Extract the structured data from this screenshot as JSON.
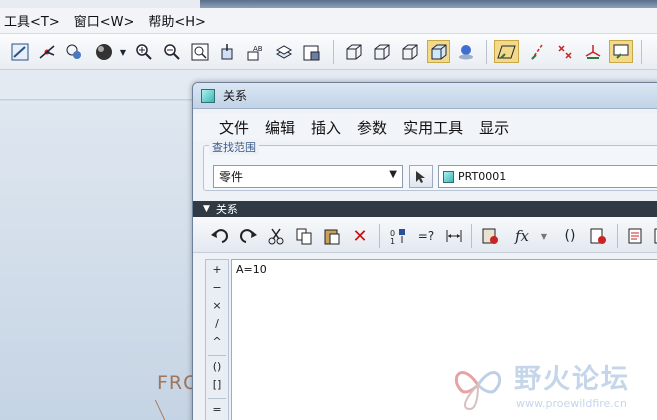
{
  "app_menu": {
    "items": [
      "工具<T>",
      "窗口<W>",
      "帮助<H>"
    ]
  },
  "toolbar": {
    "icons": [
      "repaint-icon",
      "spin-center-icon",
      "orient-icon",
      "appearance-icon",
      "zoom-in-icon",
      "zoom-out-icon",
      "refit-icon",
      "saved-views-icon",
      "annotation-icon",
      "layers-icon",
      "view-manager-icon",
      "wireframe-icon",
      "hidden-line-icon",
      "no-hidden-icon",
      "shading-icon",
      "display-style-icon",
      "datum-planes-icon",
      "datum-axes-icon",
      "datum-points-icon",
      "coordinate-systems-icon",
      "annotation-display-icon"
    ]
  },
  "graphics": {
    "datum_label": "FRO"
  },
  "dialog": {
    "title": "关系",
    "menu": [
      "文件",
      "编辑",
      "插入",
      "参数",
      "实用工具",
      "显示"
    ],
    "filter": {
      "legend": "查找范围",
      "scope_value": "零件",
      "model_value": "PRT0001"
    },
    "section_title": "关系",
    "operators": [
      "+",
      "−",
      "×",
      "/",
      "^",
      "()",
      "[]",
      "="
    ],
    "editor_text": "A=10"
  },
  "watermark": {
    "text": "野火论坛",
    "url": "www.proewildfire.cn"
  }
}
